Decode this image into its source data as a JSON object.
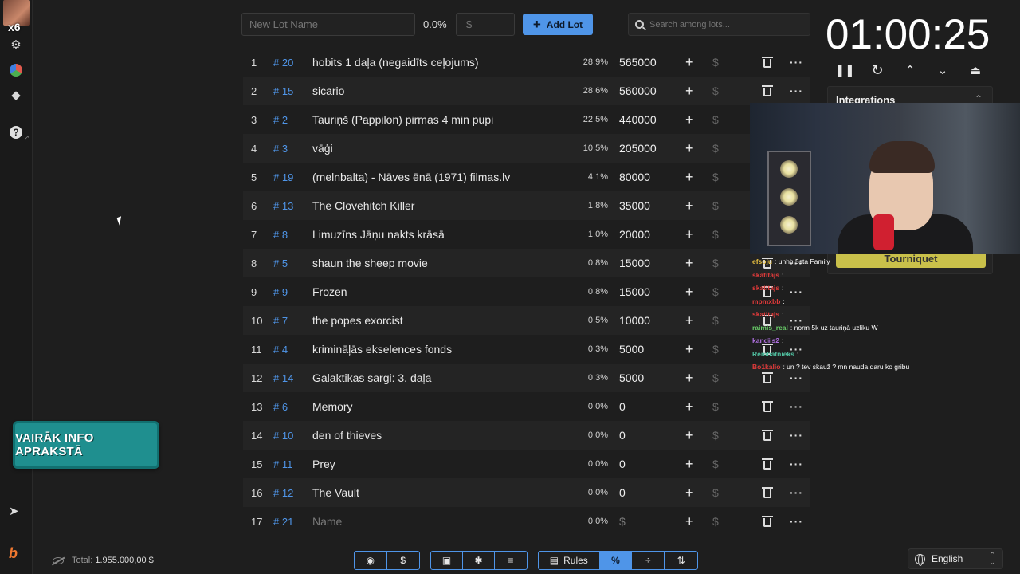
{
  "sidebar": {
    "multiplier": "x6",
    "icons": [
      "settings-icon",
      "pie-chart-icon",
      "layers-icon",
      "help-icon",
      "telegram-icon",
      "boosty-icon"
    ]
  },
  "banner_text": "VAIRĀK INFO APRAKSTĀ",
  "toolbar": {
    "lot_name_placeholder": "New Lot Name",
    "percent": "0.0%",
    "amount_placeholder": "$",
    "add_lot_label": "Add Lot",
    "search_placeholder": "Search among lots..."
  },
  "lots": [
    {
      "idx": "1",
      "id": "# 20",
      "name": "hobits 1 daļa (negaidīts ceļojums)",
      "pct": "28.9%",
      "amount": "565000"
    },
    {
      "idx": "2",
      "id": "# 15",
      "name": "sicario",
      "pct": "28.6%",
      "amount": "560000"
    },
    {
      "idx": "3",
      "id": "# 2",
      "name": "Tauriņš (Pappilon) pirmas 4 min pupi",
      "pct": "22.5%",
      "amount": "440000"
    },
    {
      "idx": "4",
      "id": "# 3",
      "name": "vāģi",
      "pct": "10.5%",
      "amount": "205000"
    },
    {
      "idx": "5",
      "id": "# 19",
      "name": "(melnbalta) - Nāves ēnā (1971) filmas.lv",
      "pct": "4.1%",
      "amount": "80000"
    },
    {
      "idx": "6",
      "id": "# 13",
      "name": "The Clovehitch Killer",
      "pct": "1.8%",
      "amount": "35000"
    },
    {
      "idx": "7",
      "id": "# 8",
      "name": "Limuzīns Jāņu nakts krāsā",
      "pct": "1.0%",
      "amount": "20000"
    },
    {
      "idx": "8",
      "id": "# 5",
      "name": "shaun the sheep movie",
      "pct": "0.8%",
      "amount": "15000"
    },
    {
      "idx": "9",
      "id": "# 9",
      "name": "Frozen",
      "pct": "0.8%",
      "amount": "15000"
    },
    {
      "idx": "10",
      "id": "# 7",
      "name": "the popes exorcist",
      "pct": "0.5%",
      "amount": "10000"
    },
    {
      "idx": "11",
      "id": "# 4",
      "name": "krimināļās ekselences fonds",
      "pct": "0.3%",
      "amount": "5000"
    },
    {
      "idx": "12",
      "id": "# 14",
      "name": "Galaktikas sargi: 3. daļa",
      "pct": "0.3%",
      "amount": "5000"
    },
    {
      "idx": "13",
      "id": "# 6",
      "name": "Memory",
      "pct": "0.0%",
      "amount": "0"
    },
    {
      "idx": "14",
      "id": "# 10",
      "name": "den of thieves",
      "pct": "0.0%",
      "amount": "0"
    },
    {
      "idx": "15",
      "id": "# 11",
      "name": "Prey",
      "pct": "0.0%",
      "amount": "0"
    },
    {
      "idx": "16",
      "id": "# 12",
      "name": "The Vault",
      "pct": "0.0%",
      "amount": "0"
    },
    {
      "idx": "17",
      "id": "# 21",
      "name": "Name",
      "pct": "0.0%",
      "amount": "$",
      "empty": true
    }
  ],
  "timer": {
    "display": "01:00:25",
    "controls": [
      "pause-icon",
      "restart-icon",
      "increase-icon",
      "decrease-icon",
      "eject-icon"
    ]
  },
  "integrations": {
    "title": "Integrations",
    "tourniquet_label": "Tourniquet"
  },
  "chat": [
    {
      "user": "efsoju",
      "user_color": "#e8c040",
      "msg": ": uhhh 5sta Family"
    },
    {
      "user": "skatitajs",
      "user_color": "#e03a3a",
      "msg": ":"
    },
    {
      "user": "skatitajs",
      "user_color": "#e03a3a",
      "msg": ":"
    },
    {
      "user": "mpmxbb",
      "user_color": "#e03a3a",
      "msg": ":"
    },
    {
      "user": "skatitajs",
      "user_color": "#e03a3a",
      "msg": ":"
    },
    {
      "user": "raimis_real",
      "user_color": "#6ad06a",
      "msg": ": norm 5k uz tauriņā uzliku W"
    },
    {
      "user": "kandiis2",
      "user_color": "#b070e0",
      "msg": ":"
    },
    {
      "user": "Rembatnieks",
      "user_color": "#50c0a0",
      "msg": ":"
    },
    {
      "user": "Bo1kalio",
      "user_color": "#e03a3a",
      "msg": ": un ? tev skauž ? mn nauda daru ko gribu"
    }
  ],
  "footer": {
    "total_label": "Total:",
    "total_value": "1.955.000,00 $",
    "rules_label": "Rules",
    "language": "English"
  },
  "colors": {
    "accent": "#4f95e8",
    "background": "#1e1e1e",
    "banner": "#1f8f8f"
  }
}
